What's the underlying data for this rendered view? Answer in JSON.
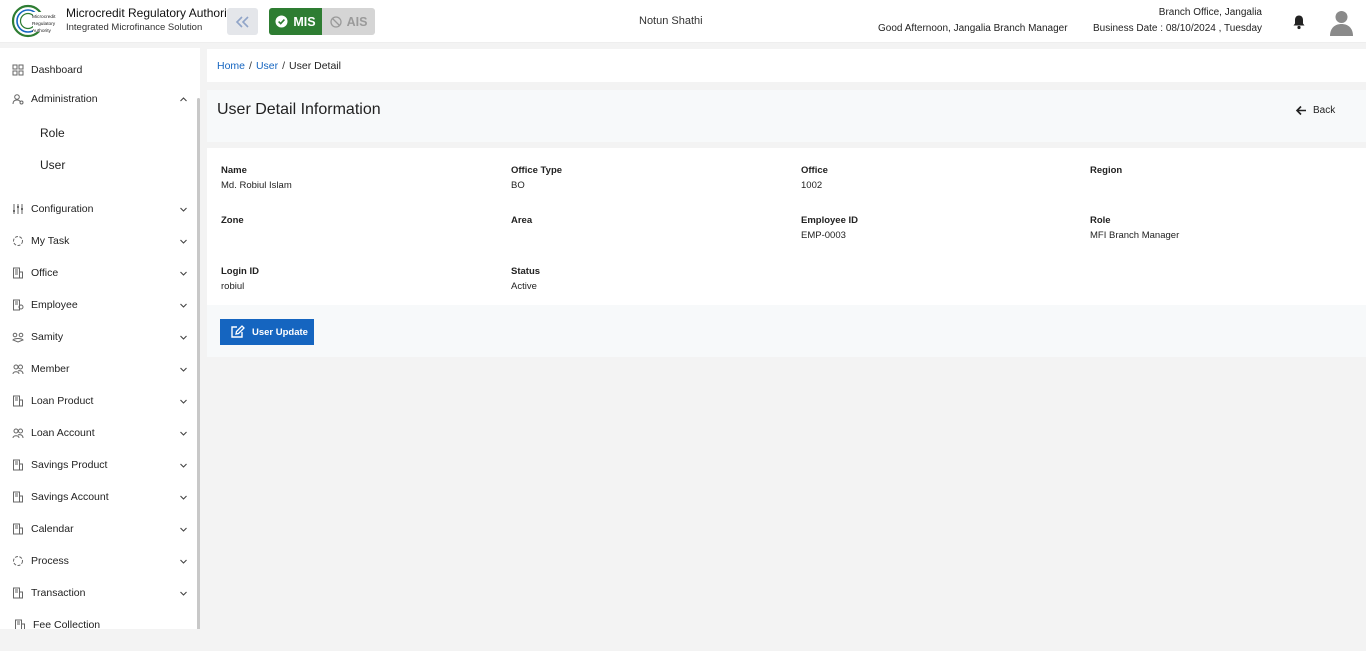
{
  "header": {
    "org_name": "Microcredit Regulatory Authority",
    "org_subtitle": "Integrated Microfinance Solution",
    "logo_text_1": "Microcredit",
    "logo_text_2": "Regulatory",
    "logo_text_3": "Authority",
    "toggle_mis": "MIS",
    "toggle_ais": "AIS",
    "app_name": "Notun Shathi",
    "greeting": "Good Afternoon, Jangalia Branch Manager",
    "branch": "Branch Office, Jangalia",
    "business_date": "Business Date : 08/10/2024 , Tuesday",
    "accent_green": "#2e7d32",
    "accent_blue": "#1565c0"
  },
  "sidebar": {
    "items": [
      {
        "label": "Dashboard",
        "icon": "grid-icon"
      },
      {
        "label": "Administration",
        "icon": "admin-icon",
        "expanded": true
      },
      {
        "label": "Role"
      },
      {
        "label": "User"
      },
      {
        "label": "Configuration",
        "icon": "sliders-icon"
      },
      {
        "label": "My Task",
        "icon": "task-icon"
      },
      {
        "label": "Office",
        "icon": "office-icon"
      },
      {
        "label": "Employee",
        "icon": "employee-icon"
      },
      {
        "label": "Samity",
        "icon": "samity-icon"
      },
      {
        "label": "Member",
        "icon": "member-icon"
      },
      {
        "label": "Loan Product",
        "icon": "loan-product-icon"
      },
      {
        "label": "Loan Account",
        "icon": "loan-account-icon"
      },
      {
        "label": "Savings Product",
        "icon": "savings-product-icon"
      },
      {
        "label": "Savings Account",
        "icon": "savings-account-icon"
      },
      {
        "label": "Calendar",
        "icon": "calendar-icon"
      },
      {
        "label": "Process",
        "icon": "process-icon"
      },
      {
        "label": "Transaction",
        "icon": "transaction-icon"
      },
      {
        "label": "Fee Collection",
        "icon": "fee-icon"
      }
    ]
  },
  "breadcrumb": {
    "home": "Home",
    "sep": "/",
    "user": "User",
    "current": "User Detail"
  },
  "page": {
    "title": "User Detail Information",
    "back_label": "Back",
    "update_label": "User Update"
  },
  "details": {
    "name": {
      "label": "Name",
      "value": "Md. Robiul Islam"
    },
    "office_type": {
      "label": "Office Type",
      "value": "BO"
    },
    "office": {
      "label": "Office",
      "value": "1002"
    },
    "region": {
      "label": "Region",
      "value": ""
    },
    "zone": {
      "label": "Zone",
      "value": ""
    },
    "area": {
      "label": "Area",
      "value": ""
    },
    "employee_id": {
      "label": "Employee ID",
      "value": "EMP-0003"
    },
    "role": {
      "label": "Role",
      "value": "MFI Branch Manager"
    },
    "login_id": {
      "label": "Login ID",
      "value": "robiul"
    },
    "status": {
      "label": "Status",
      "value": "Active"
    }
  }
}
